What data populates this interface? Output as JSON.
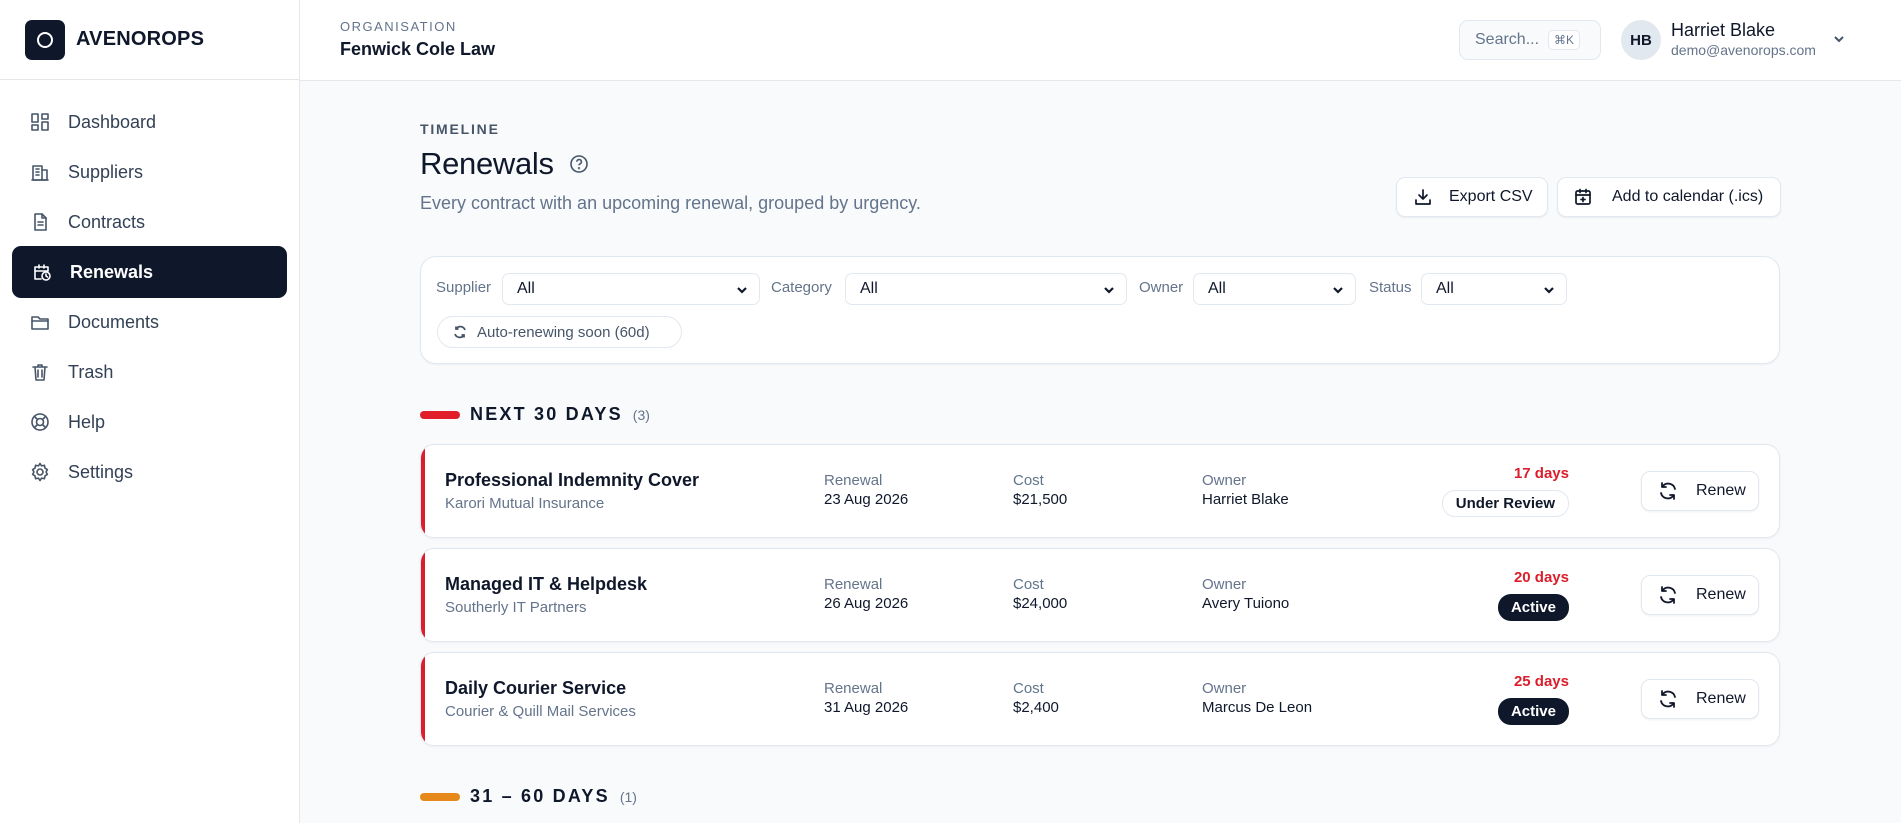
{
  "brand": {
    "name": "AVENOROPS"
  },
  "sidebar": {
    "items": [
      {
        "label": "Dashboard",
        "icon": "dashboard-icon"
      },
      {
        "label": "Suppliers",
        "icon": "building-icon"
      },
      {
        "label": "Contracts",
        "icon": "document-icon"
      },
      {
        "label": "Renewals",
        "icon": "calendar-clock-icon",
        "active": true
      },
      {
        "label": "Documents",
        "icon": "folder-icon"
      },
      {
        "label": "Trash",
        "icon": "trash-icon"
      },
      {
        "label": "Help",
        "icon": "lifebuoy-icon"
      },
      {
        "label": "Settings",
        "icon": "gear-icon"
      }
    ]
  },
  "header": {
    "org_caption": "ORGANISATION",
    "org_name": "Fenwick Cole Law",
    "search_placeholder": "Search...",
    "search_shortcut": "⌘K",
    "user_initials": "HB",
    "user_name": "Harriet Blake",
    "user_email": "demo@avenorops.com"
  },
  "page": {
    "eyebrow": "TIMELINE",
    "title": "Renewals",
    "subtitle": "Every contract with an upcoming renewal, grouped by urgency.",
    "export_label": "Export CSV",
    "calendar_label": "Add to calendar (.ics)"
  },
  "filters": {
    "supplier_label": "Supplier",
    "supplier_value": "All",
    "category_label": "Category",
    "category_value": "All",
    "owner_label": "Owner",
    "owner_value": "All",
    "status_label": "Status",
    "status_value": "All",
    "chip_label": "Auto-renewing soon (60d)"
  },
  "groups": [
    {
      "title": "NEXT 30 DAYS",
      "count": "(3)",
      "color": "#e11d2a"
    },
    {
      "title": "31 – 60 DAYS",
      "count": "(1)",
      "color": "#e6891a"
    }
  ],
  "renewals": [
    {
      "name": "Professional Indemnity Cover",
      "supplier": "Karori Mutual Insurance",
      "renewal_label": "Renewal",
      "renewal_date": "23 Aug 2026",
      "cost_label": "Cost",
      "cost": "$21,500",
      "owner_label": "Owner",
      "owner": "Harriet Blake",
      "days": "17 days",
      "status": "Under Review",
      "action": "Renew"
    },
    {
      "name": "Managed IT & Helpdesk",
      "supplier": "Southerly IT Partners",
      "renewal_label": "Renewal",
      "renewal_date": "26 Aug 2026",
      "cost_label": "Cost",
      "cost": "$24,000",
      "owner_label": "Owner",
      "owner": "Avery Tuiono",
      "days": "20 days",
      "status": "Active",
      "action": "Renew"
    },
    {
      "name": "Daily Courier Service",
      "supplier": "Courier & Quill Mail Services",
      "renewal_label": "Renewal",
      "renewal_date": "31 Aug 2026",
      "cost_label": "Cost",
      "cost": "$2,400",
      "owner_label": "Owner",
      "owner": "Marcus De Leon",
      "days": "25 days",
      "status": "Active",
      "action": "Renew"
    }
  ],
  "colors": {
    "primary": "#0f172a",
    "urgent": "#dc1e2c",
    "warning": "#e6891a",
    "muted": "#64748b"
  }
}
